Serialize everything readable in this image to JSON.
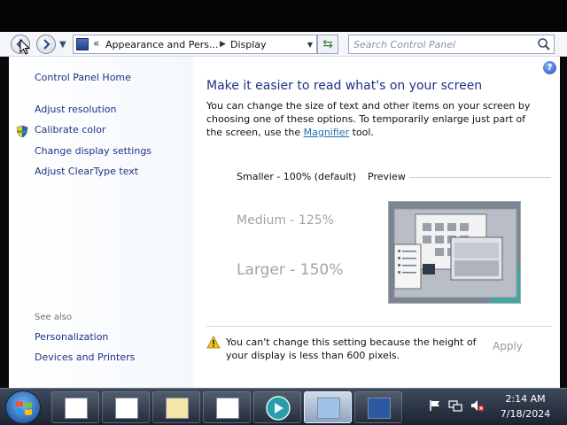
{
  "navigation": {
    "breadcrumb": [
      "Appearance and Pers...",
      "Display"
    ],
    "breadcrumb_overflow": "«",
    "search_placeholder": "Search Control Panel"
  },
  "sidebar": {
    "items": [
      {
        "label": "Control Panel Home"
      },
      {
        "label": "Adjust resolution"
      },
      {
        "label": "Calibrate color"
      },
      {
        "label": "Change display settings"
      },
      {
        "label": "Adjust ClearType text"
      }
    ],
    "see_also_label": "See also",
    "see_also_items": [
      {
        "label": "Personalization"
      },
      {
        "label": "Devices and Printers"
      }
    ]
  },
  "main": {
    "heading": "Make it easier to read what's on your screen",
    "description_before": "You can change the size of text and other items on your screen by choosing one of these options. To temporarily enlarge just part of the screen, use the ",
    "description_link": "Magnifier",
    "description_after": " tool.",
    "options": [
      {
        "label": "Smaller - 100% (default)"
      },
      {
        "label": "Medium - 125%"
      },
      {
        "label": "Larger - 150%"
      }
    ],
    "preview_label": "Preview",
    "warning": "You can't change this setting because the height of your display is less than 600 pixels.",
    "apply_label": "Apply"
  },
  "taskbar": {
    "time": "2:14 AM",
    "date": "7/18/2024"
  },
  "colors": {
    "link": "#1e3287",
    "accent": "#1f6fae",
    "disabled_text": "#a3a3a3"
  },
  "icons": [
    "back-icon",
    "forward-icon",
    "control-panel-icon",
    "refresh-icon",
    "search-icon",
    "help-icon",
    "shield-icon",
    "warning-icon",
    "windows-start-icon",
    "flag-icon",
    "network-icon",
    "volume-muted-icon"
  ]
}
